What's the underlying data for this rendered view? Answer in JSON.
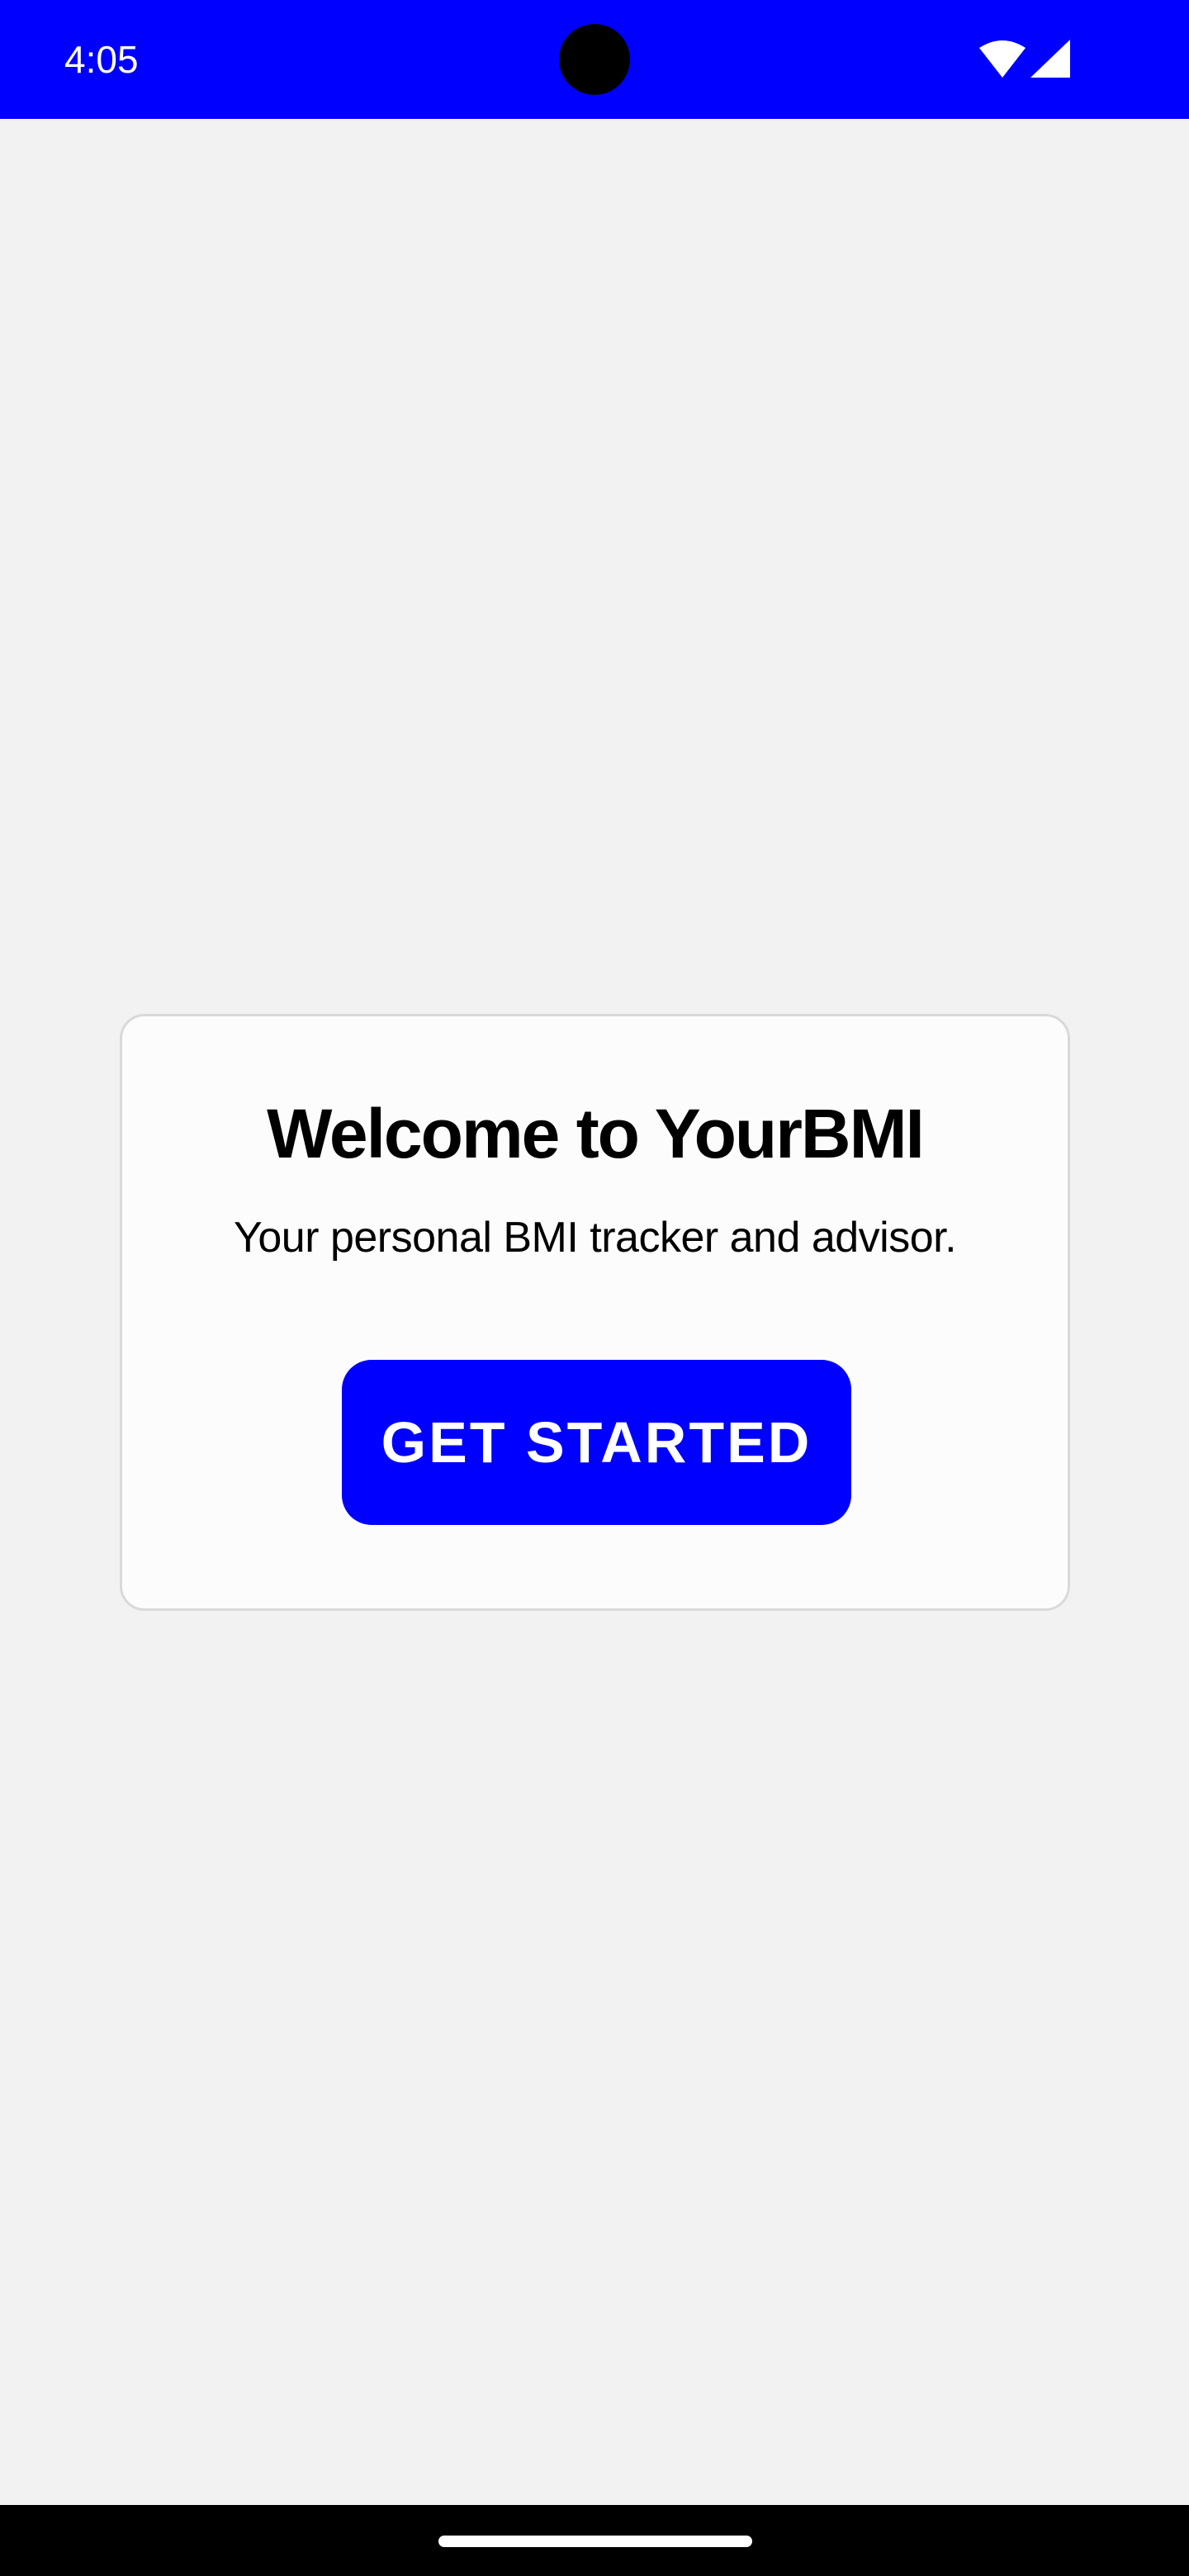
{
  "status_bar": {
    "time": "4:05",
    "icons": [
      "wifi-icon",
      "signal-icon"
    ],
    "background_color": "#0000ff"
  },
  "welcome_card": {
    "title": "Welcome to YourBMI",
    "subtitle": "Your personal BMI tracker and advisor.",
    "button_label": "GET STARTED",
    "button_color": "#0000ff"
  }
}
